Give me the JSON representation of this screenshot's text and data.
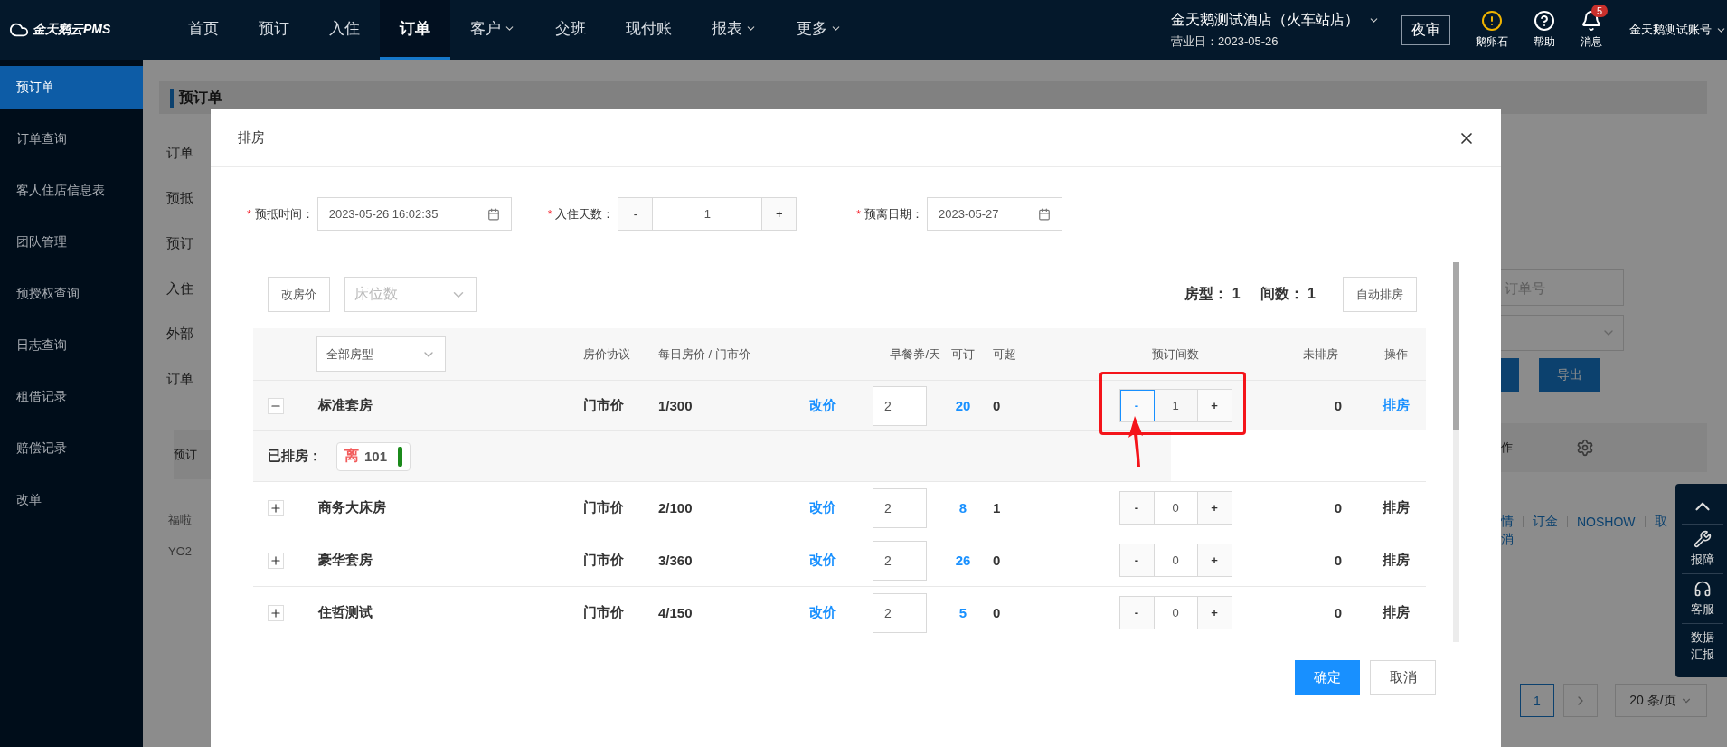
{
  "topbar": {
    "logo": "金天鹅云PMS",
    "nav": [
      {
        "label": "首页",
        "selected": false,
        "dropdown": false
      },
      {
        "label": "预订",
        "selected": false,
        "dropdown": false
      },
      {
        "label": "入住",
        "selected": false,
        "dropdown": false
      },
      {
        "label": "订单",
        "selected": true,
        "dropdown": false
      },
      {
        "label": "客户",
        "selected": false,
        "dropdown": true
      },
      {
        "label": "交班",
        "selected": false,
        "dropdown": false
      },
      {
        "label": "现付账",
        "selected": false,
        "dropdown": false
      },
      {
        "label": "报表",
        "selected": false,
        "dropdown": true
      },
      {
        "label": "更多",
        "selected": false,
        "dropdown": true
      }
    ],
    "hotel": {
      "name": "金天鹅测试酒店（火车站店）",
      "business_day": "营业日：2023-05-26"
    },
    "night_audit": "夜审",
    "tools": [
      {
        "kind": "alert",
        "label": "鹅卵石"
      },
      {
        "kind": "help",
        "label": "帮助"
      },
      {
        "kind": "bell",
        "label": "消息",
        "badge": "5"
      }
    ],
    "account": "金天鹅测试账号"
  },
  "sidebar": {
    "items": [
      {
        "label": "预订单",
        "selected": true
      },
      {
        "label": "订单查询",
        "selected": false
      },
      {
        "label": "客人住店信息表",
        "selected": false
      },
      {
        "label": "团队管理",
        "selected": false
      },
      {
        "label": "预授权查询",
        "selected": false
      },
      {
        "label": "日志查询",
        "selected": false
      },
      {
        "label": "租借记录",
        "selected": false
      },
      {
        "label": "赔偿记录",
        "selected": false
      },
      {
        "label": "改单",
        "selected": false
      }
    ]
  },
  "page": {
    "title": "预订单",
    "left_labels": [
      "订单",
      "预抵",
      "预订",
      "入住",
      "外部",
      "订单"
    ],
    "table_header_left": "预订",
    "row_texts": [
      "福啦",
      "YO2"
    ],
    "search_placeholder": "订单号",
    "export_button": "导出",
    "table_header_right": "作",
    "links": [
      "情",
      "订金",
      "NOSHOW",
      "取"
    ],
    "link_second_line": "消",
    "pagination": {
      "page": "1",
      "page_size": "20 条/页"
    },
    "float_panel": [
      {
        "kind": "top"
      },
      {
        "kind": "wrench",
        "label": "报障"
      },
      {
        "kind": "headset",
        "label": "客服"
      },
      {
        "kind": "text",
        "label": "数据汇报"
      }
    ]
  },
  "dialog": {
    "title": "排房",
    "fields": [
      {
        "kind": "datetime",
        "marker": "*",
        "label": "预抵时间：",
        "value": "2023-05-26 16:02:35"
      },
      {
        "kind": "stepper",
        "marker": "*",
        "label": "入住天数：",
        "minus": "-",
        "value": "1",
        "plus": "+"
      },
      {
        "kind": "date",
        "marker": "*",
        "label": "预离日期：",
        "value": "2023-05-27"
      }
    ],
    "toolbar": {
      "change_price": "改房价",
      "bed_placeholder": "床位数",
      "summary": [
        {
          "label": "房型：",
          "value": "1"
        },
        {
          "label": "间数：",
          "value": "1"
        }
      ],
      "auto_assign": "自动排房"
    },
    "room_type_select": "全部房型",
    "headers": [
      "房价协议",
      "每日房价 / 门市价",
      "早餐券/天",
      "可订",
      "可超",
      "预订间数",
      "未排房",
      "操作"
    ],
    "rows": [
      {
        "name": "标准套房",
        "expanded": true,
        "protocol": "门市价",
        "price": "1/300",
        "change_price": "改价",
        "breakfast": "2",
        "available": "20",
        "over": "0",
        "count": {
          "minus": "-",
          "value": "1",
          "plus": "+",
          "minus_focused": true,
          "highlighted": true
        },
        "unassigned": "0",
        "action": "排房",
        "action_active": true,
        "assigned": {
          "label": "已排房：",
          "rooms": [
            {
              "tag": "离",
              "number": "101",
              "color": "#1b8a1b"
            }
          ]
        }
      },
      {
        "name": "商务大床房",
        "expanded": false,
        "protocol": "门市价",
        "price": "2/100",
        "change_price": "改价",
        "breakfast": "2",
        "available": "8",
        "over": "1",
        "count": {
          "minus": "-",
          "value": "0",
          "plus": "+",
          "minus_focused": false,
          "highlighted": false
        },
        "unassigned": "0",
        "action": "排房",
        "action_active": false
      },
      {
        "name": "豪华套房",
        "expanded": false,
        "protocol": "门市价",
        "price": "3/360",
        "change_price": "改价",
        "breakfast": "2",
        "available": "26",
        "over": "0",
        "count": {
          "minus": "-",
          "value": "0",
          "plus": "+",
          "minus_focused": false,
          "highlighted": false
        },
        "unassigned": "0",
        "action": "排房",
        "action_active": false
      },
      {
        "name": "住哲测试",
        "expanded": false,
        "protocol": "门市价",
        "price": "4/150",
        "change_price": "改价",
        "breakfast": "2",
        "available": "5",
        "over": "0",
        "count": {
          "minus": "-",
          "value": "0",
          "plus": "+",
          "minus_focused": false,
          "highlighted": false
        },
        "unassigned": "0",
        "action": "排房",
        "action_active": false
      }
    ],
    "buttons": [
      {
        "kind": "primary",
        "label": "确定"
      },
      {
        "kind": "default",
        "label": "取消"
      }
    ]
  }
}
